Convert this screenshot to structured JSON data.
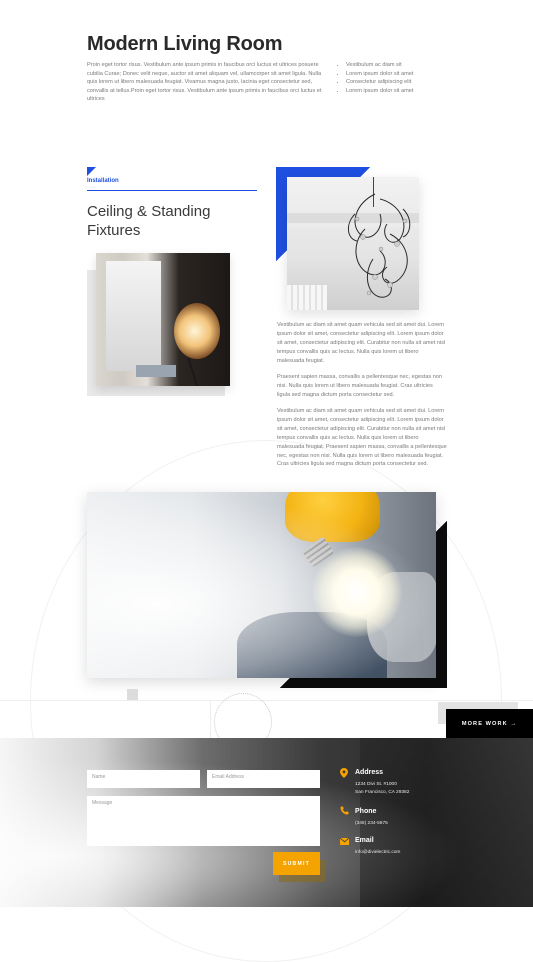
{
  "intro": {
    "title": "Modern Living Room",
    "text": "Proin eget tortor risus. Vestibulum ante ipsum primis in faucibus orci luctus et ultrices posuere cubilia Curae; Donec velit neque, auctor sit amet aliquam vel, ullamcorper sit amet ligula. Nulla quis lorem ut libero malesuada feugiat. Vivamus magna justo, lacinia eget consectetur sed, convallis at tellus.Proin eget tortor risus. Vestibulum ante ipsum primis in faucibus orci luctus et ultrices",
    "bullets": [
      "Vestibulum ac diam sit",
      "Lorem ipsum dolor sit amet",
      "Consectetur adipiscing elit",
      "Lorem ipsum dolor sit amet"
    ]
  },
  "installation": {
    "label": "Installation",
    "heading": "Ceiling & Standing Fixtures"
  },
  "body_paragraphs": [
    "Vestibulum ac diam sit amet quam vehicula sed sit amet dui. Lorem ipsum dolor sit amet, consectetur adipiscing elit. Lorem ipsum dolor sit amet, consectetur adipiscing elit. Curabitur non nulla sit amet nisl tempus convallis quis ac lectus. Nulla quis lorem ut libero malesuada feugiat.",
    "Praesent sapien massa, convallis a pellentesque nec, egestas non nisi. Nulla quis lorem ut libero malesuada feugiat. Cras ultricies ligula sed magna dictum porta consectetur sed.",
    "Vestibulum ac diam sit amet quam vehicula sed sit amet dui. Lorem ipsum dolor sit amet, consectetur adipiscing elit. Lorem ipsum dolor sit amet, consectetur adipiscing elit. Curabitur non nulla sit amet nisl tempus convallis quis ac lectus. Nulla quis lorem ut libero malesuada feugiat. Praesent sapien massa, convallis a pellentesque nec, egestas non nisi. Nulla quis lorem ut libero malesuada feugiat. Cras ultricies ligula sed magna dictum porta consectetur sed."
  ],
  "more_work": {
    "label": "MORE WORK →"
  },
  "form": {
    "name_placeholder": "Name",
    "email_placeholder": "Email Address",
    "message_placeholder": "Message",
    "submit_label": "SUBMIT"
  },
  "contact": {
    "address": {
      "title": "Address",
      "lines": [
        "1234 Divi St. #1000",
        "San Francisco, CA 29382"
      ],
      "icon": "map-pin-icon"
    },
    "phone": {
      "title": "Phone",
      "lines": [
        "(346) 234-5675"
      ],
      "icon": "phone-icon"
    },
    "email": {
      "title": "Email",
      "lines": [
        "info@divielectric.com"
      ],
      "icon": "envelope-icon"
    }
  },
  "colors": {
    "accent_blue": "#1f4fe0",
    "accent_orange": "#f5a300",
    "black": "#000000"
  }
}
